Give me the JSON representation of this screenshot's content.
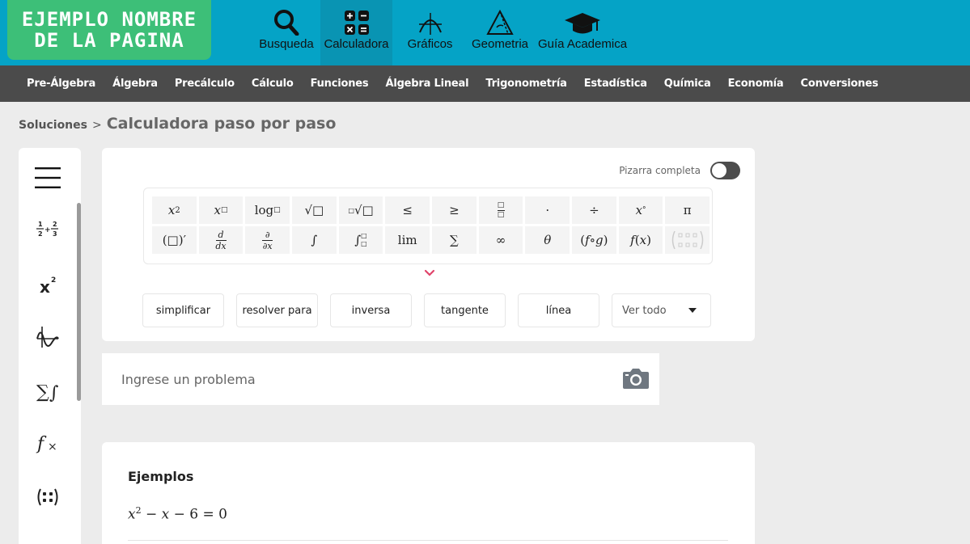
{
  "header": {
    "logo_line1": "EJEMPLO NOMBRE",
    "logo_line2": "DE LA PAGINA",
    "nav": [
      {
        "label": "Busqueda",
        "icon": "search-icon"
      },
      {
        "label": "Calculadora",
        "icon": "calculator-icon",
        "active": true
      },
      {
        "label": "Gráficos",
        "icon": "graph-icon"
      },
      {
        "label": "Geometria",
        "icon": "geometry-icon"
      },
      {
        "label": "Guía Academica",
        "icon": "graduation-cap-icon"
      }
    ],
    "colors": {
      "bar": "#05a3c6",
      "logo": "#3dbf78",
      "active": "#0994b3"
    }
  },
  "subjects": [
    "Pre-Álgebra",
    "Álgebra",
    "Precálculo",
    "Cálculo",
    "Funciones",
    "Álgebra Lineal",
    "Trigonometría",
    "Estadística",
    "Química",
    "Economía",
    "Conversiones"
  ],
  "breadcrumb": {
    "root": "Soluciones",
    "sep": ">",
    "current": "Calculadora paso por paso"
  },
  "sidebar": {
    "icons": [
      "menu-icon",
      "fractions-icon",
      "exponent-icon",
      "trig-graph-icon",
      "sum-integral-icon",
      "function-icon",
      "matrix-icon"
    ]
  },
  "panel": {
    "toggle_label": "Pizarra completa",
    "toggle_on": false,
    "row1": [
      "x²",
      "x□",
      "log□",
      "√□",
      "∛□",
      "≤",
      "≥",
      "□/□",
      "·",
      "÷",
      "x°",
      "π"
    ],
    "row2": [
      "(□)′",
      "d/dx",
      "∂/∂x",
      "∫",
      "∫□",
      "lim",
      "∑",
      "∞",
      "θ",
      "(f∘g)",
      "f(x)",
      "matrix"
    ],
    "actions": [
      "simplificar",
      "resolver para",
      "inversa",
      "tangente",
      "línea"
    ],
    "select_label": "Ver todo"
  },
  "search": {
    "placeholder": "Ingrese un problema",
    "value": ""
  },
  "examples": {
    "title": "Ejemplos",
    "items": [
      "x² − x − 6 = 0"
    ]
  }
}
